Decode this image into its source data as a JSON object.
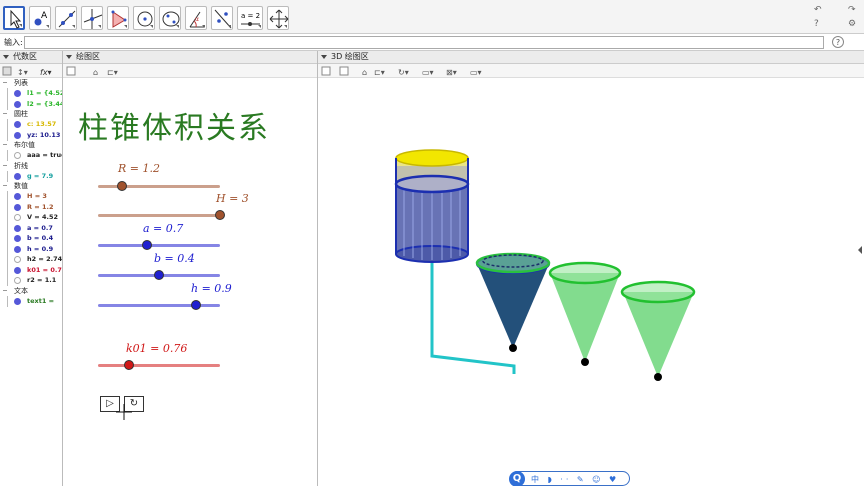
{
  "toolbar": {
    "tools": [
      "move-tool",
      "point-tool",
      "line-tool",
      "perpendicular-tool",
      "polygon-tool",
      "circle-tool",
      "conic-tool",
      "angle-tool",
      "reflect-tool",
      "slider-tool",
      "move-view-tool"
    ],
    "slider_tool_label": "a = 2",
    "undo": "↶",
    "redo": "↷",
    "help": "?",
    "settings": "⚙"
  },
  "inputbar": {
    "label": "输入:",
    "value": "",
    "help": "?"
  },
  "panels": {
    "algebra_title": "代数区",
    "graphics_title": "绘图区",
    "graphics3d_title": "3D 绘图区"
  },
  "algebra": {
    "categories": [
      {
        "label": "列表",
        "items": [
          {
            "text": "l1 = {4.52,",
            "color": "#2ab52a",
            "visible": true
          },
          {
            "text": "l2 = {3.44}",
            "color": "#2ab52a",
            "visible": true
          }
        ]
      },
      {
        "label": "圆柱",
        "items": [
          {
            "text": "c: 13.57",
            "color": "#d6b800",
            "visible": true
          },
          {
            "text": "yz: 10.13",
            "color": "#1a1a8c",
            "visible": true
          }
        ]
      },
      {
        "label": "布尔值",
        "items": [
          {
            "text": "aaa = true",
            "color": "#222",
            "visible": false
          }
        ]
      },
      {
        "label": "折线",
        "items": [
          {
            "text": "g = 7.9",
            "color": "#16a0a0",
            "visible": true
          }
        ]
      },
      {
        "label": "数值",
        "items": [
          {
            "text": "H = 3",
            "color": "#a0522d",
            "visible": true
          },
          {
            "text": "R = 1.2",
            "color": "#a0522d",
            "visible": true
          },
          {
            "text": "V = 4.52",
            "color": "#222",
            "visible": false
          },
          {
            "text": "a = 0.7",
            "color": "#1a1a8c",
            "visible": true
          },
          {
            "text": "b = 0.4",
            "color": "#1a1a8c",
            "visible": true
          },
          {
            "text": "h = 0.9",
            "color": "#1a1a8c",
            "visible": true
          },
          {
            "text": "h2 = 2.74",
            "color": "#222",
            "visible": false
          },
          {
            "text": "k01 = 0.76",
            "color": "#c8102e",
            "visible": true
          },
          {
            "text": "r2 = 1.1",
            "color": "#222",
            "visible": false
          }
        ]
      },
      {
        "label": "文本",
        "items": [
          {
            "text": "text1 =",
            "color": "#2a7a22",
            "visible": true
          }
        ]
      }
    ]
  },
  "graphics": {
    "title": "柱锥体积关系",
    "sliders": [
      {
        "label": "R = 1.2",
        "color": "#a0522d",
        "value": 1.2,
        "min": 0,
        "max": 3,
        "fraction": 0.2
      },
      {
        "label": "H = 3",
        "color": "#a0522d",
        "value": 3,
        "min": 0,
        "max": 3,
        "fraction": 1.0
      },
      {
        "label": "a = 0.7",
        "color": "#2020d0",
        "value": 0.7,
        "min": 0,
        "max": 1,
        "fraction": 0.4
      },
      {
        "label": "b = 0.4",
        "color": "#2020d0",
        "value": 0.4,
        "min": 0,
        "max": 1,
        "fraction": 0.5
      },
      {
        "label": "h = 0.9",
        "color": "#2020d0",
        "value": 0.9,
        "min": 0,
        "max": 1,
        "fraction": 0.8
      },
      {
        "label": "k01 = 0.76",
        "color": "#d01818",
        "value": 0.76,
        "min": 0,
        "max": 1,
        "fraction": 0.25
      }
    ],
    "play_label": "▷",
    "reset_label": "↻"
  },
  "bottombar": {
    "icon": "Q",
    "items": "中 ◗ ·· ✎ ☺ ♥ ▦"
  },
  "colors": {
    "cylinder_yellow": "#f2e600",
    "cylinder_blue": "#1c2fb0",
    "cone_dark": "#23507a",
    "cone_green": "#4cd05a",
    "pipe": "#22c4c8"
  }
}
